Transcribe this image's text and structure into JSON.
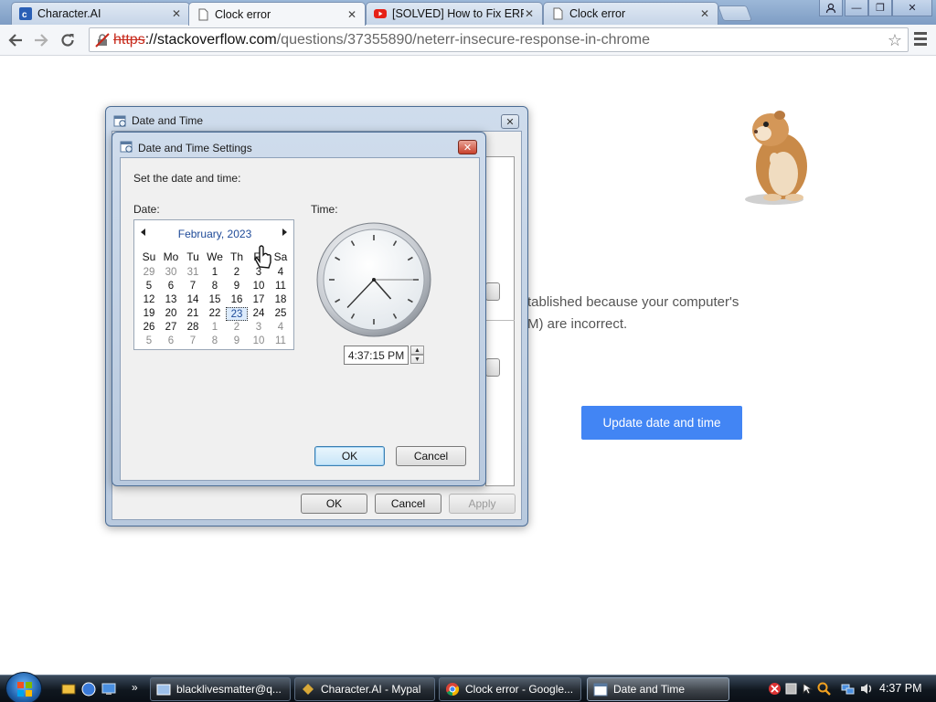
{
  "browser": {
    "tabs": [
      {
        "title": "Character.AI",
        "icon": "character-ai-icon",
        "active": false
      },
      {
        "title": "Clock error",
        "icon": "page-icon",
        "active": true
      },
      {
        "title": "[SOLVED] How to Fix ERR_",
        "icon": "youtube-icon",
        "active": false
      },
      {
        "title": "Clock error",
        "icon": "page-icon",
        "active": false
      }
    ],
    "url_scheme": "https",
    "url_host": "://stackoverflow.com",
    "url_path": "/questions/37355890/neterr-insecure-response-in-chrome"
  },
  "page": {
    "message_line1": "tablished because your computer's",
    "message_line2": "M) are incorrect.",
    "update_button": "Update date and time"
  },
  "outer_dialog": {
    "title": "Date and Time",
    "ok": "OK",
    "cancel": "Cancel",
    "apply": "Apply"
  },
  "inner_dialog": {
    "title": "Date and Time Settings",
    "instruction": "Set the date and time:",
    "date_label": "Date:",
    "time_label": "Time:",
    "calendar": {
      "month": "February, 2023",
      "days_of_week": [
        "Su",
        "Mo",
        "Tu",
        "We",
        "Th",
        "Fr",
        "Sa"
      ],
      "weeks": [
        [
          "29",
          "30",
          "31",
          "1",
          "2",
          "3",
          "4"
        ],
        [
          "5",
          "6",
          "7",
          "8",
          "9",
          "10",
          "11"
        ],
        [
          "12",
          "13",
          "14",
          "15",
          "16",
          "17",
          "18"
        ],
        [
          "19",
          "20",
          "21",
          "22",
          "23",
          "24",
          "25"
        ],
        [
          "26",
          "27",
          "28",
          "1",
          "2",
          "3",
          "4"
        ],
        [
          "5",
          "6",
          "7",
          "8",
          "9",
          "10",
          "11"
        ]
      ],
      "selected_day": "23"
    },
    "time_value": "4:37:15 PM",
    "clock": {
      "hour": 4,
      "minute": 37,
      "second": 15
    },
    "ok": "OK",
    "cancel": "Cancel"
  },
  "taskbar": {
    "tasks": [
      {
        "label": "blacklivesmatter@q...",
        "icon": "explorer-icon"
      },
      {
        "label": "Character.AI - Mypal",
        "icon": "mypal-icon"
      },
      {
        "label": "Clock error - Google...",
        "icon": "chrome-icon"
      },
      {
        "label": "Date and Time",
        "icon": "date-time-icon",
        "active": true
      }
    ],
    "clock": "4:37 PM"
  },
  "colors": {
    "accent": "#4285f4",
    "link_blue": "#1e4a98",
    "error_red": "#c7291b"
  }
}
